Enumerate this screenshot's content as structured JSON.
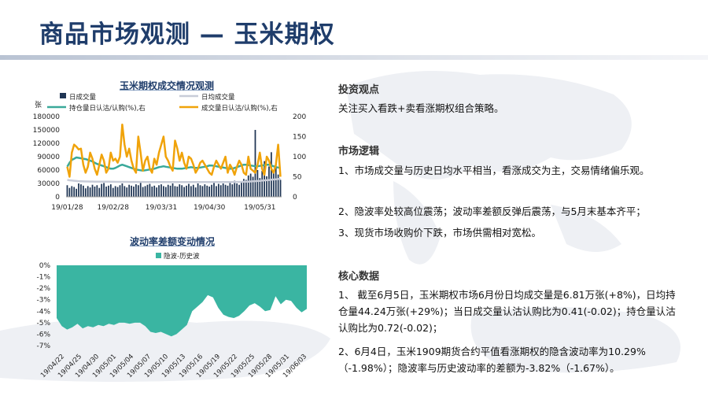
{
  "slide_title": "商品市场观测 — 玉米期权",
  "right_panel": {
    "views_heading": "投资观点",
    "views_text": "关注买入看跌+卖看涨期权组合策略。",
    "logic_heading": "市场逻辑",
    "logic_items": [
      "1、市场成交量与历史日均水平相当，看涨成交为主，交易情绪偏乐观。",
      "2、隐波率处较高位震荡；波动率差额反弹后震荡，与5月末基本齐平；",
      "3、现货市场收购价下跌，市场供需相对宽松。"
    ],
    "data_heading": "核心数据",
    "data_items": [
      "1、 截至6月5日，玉米期权市场6月份日均成交量是6.81万张(+8%)，日均持仓量44.24万张(+29%)；当日成交量认沽认购比为0.41(-0.02)；持仓量认沽认购比为0.72(-0.02)；",
      "2、6月4日，玉米1909期货合约平值看涨期权的隐含波动率为10.29%（-1.98%）；隐波率与历史波动率的差额为-3.82%（-1.67%）。"
    ]
  },
  "chart_data": [
    {
      "type": "bar",
      "title": "玉米期权成交情况观测",
      "ylabel_left": "张",
      "ylim_left": [
        0,
        180000
      ],
      "yticks_left": [
        "0",
        "30000",
        "60000",
        "90000",
        "120000",
        "150000",
        "180000"
      ],
      "ylim_right": [
        0,
        200
      ],
      "yticks_right": [
        "0",
        "50",
        "100",
        "150",
        "200"
      ],
      "xticks": [
        "19/01/28",
        "19/02/28",
        "19/03/31",
        "19/04/30",
        "19/05/31"
      ],
      "legend": [
        "日成交量",
        "日均成交量",
        "持仓量日认沽/认购(%),右",
        "成交量日认沽/认购(%),右"
      ],
      "colors": {
        "bar": "#1f3554",
        "avg": "#c8ccd8",
        "oi_ratio": "#3aa99a",
        "vol_ratio": "#f0a30a"
      },
      "series": [
        {
          "name": "日成交量",
          "axis": "left",
          "values": [
            26000,
            20000,
            24000,
            22000,
            18000,
            30000,
            28000,
            25000,
            19000,
            24000,
            21000,
            27000,
            23000,
            26000,
            20000,
            29000,
            31000,
            23000,
            25000,
            28000,
            20000,
            24000,
            22000,
            26000,
            30000,
            24000,
            21000,
            27000,
            25000,
            23000,
            28000,
            26000,
            32000,
            22000,
            24000,
            27000,
            29000,
            23000,
            25000,
            21000,
            26000,
            28000,
            24000,
            22000,
            27000,
            25000,
            30000,
            24000,
            23000,
            28000,
            26000,
            22000,
            25000,
            29000,
            24000,
            27000,
            21000,
            30000,
            26000,
            24000,
            28000,
            25000,
            23000,
            27000,
            31000,
            24000,
            29000,
            26000,
            30000,
            27000,
            25000,
            33000,
            28000,
            36000,
            30000,
            27000,
            34000,
            40000,
            38000,
            48000,
            52000,
            45000,
            150000,
            60000,
            42000,
            58000,
            80000,
            46000,
            68000,
            100000,
            55000,
            74000,
            50000,
            38000
          ]
        },
        {
          "name": "日均成交量",
          "axis": "left",
          "values": [
            38000,
            37000,
            36500,
            36000,
            35500,
            35000,
            34800,
            34600,
            34500,
            34400,
            34300,
            34200,
            34100,
            34000,
            34000,
            33900,
            33900,
            33800,
            33800,
            33700,
            33700,
            33600,
            33600,
            33600,
            33500,
            33500,
            33500,
            33400,
            33400,
            33400,
            33300,
            33300,
            33300,
            33300,
            33200,
            33200,
            33200,
            33200,
            33200,
            33100,
            33100,
            33100,
            33100,
            33100,
            33100,
            33100,
            33000,
            33000,
            33000,
            33000,
            33000,
            33000,
            33000,
            33000,
            33000,
            33000,
            33000,
            33000,
            33000,
            33000,
            33000,
            33000,
            33000,
            33000,
            33000,
            33000,
            33000,
            33000,
            33000,
            33000,
            33000,
            33000,
            33100,
            33200,
            33300,
            33400,
            33500,
            33700,
            33900,
            34100,
            34400,
            34700,
            35100,
            35500,
            35900,
            36300,
            36800,
            37300,
            37800,
            38300,
            38800,
            39300,
            39800,
            40200
          ]
        },
        {
          "name": "持仓量日认沽/认购(%),右",
          "axis": "right",
          "values": [
            75,
            85,
            92,
            95,
            98,
            97,
            96,
            95,
            94,
            92,
            90,
            88,
            85,
            82,
            80,
            78,
            76,
            74,
            72,
            70,
            70,
            72,
            75,
            78,
            80,
            78,
            76,
            74,
            72,
            70,
            68,
            67,
            66,
            65,
            66,
            67,
            68,
            69,
            70,
            72,
            74,
            75,
            76,
            75,
            74,
            73,
            72,
            71,
            70,
            70,
            70,
            71,
            72,
            73,
            74,
            73,
            72,
            72,
            73,
            74,
            75,
            76,
            78,
            78,
            77,
            76,
            75,
            74,
            73,
            72,
            71,
            70,
            70,
            72,
            74,
            76,
            78,
            80,
            80,
            79,
            78,
            77,
            76,
            76,
            77,
            78,
            79,
            80,
            80,
            78,
            76,
            74,
            73,
            72
          ]
        },
        {
          "name": "成交量日认沽/认购(%),右",
          "axis": "right",
          "values": [
            75,
            50,
            110,
            130,
            125,
            118,
            120,
            80,
            60,
            75,
            110,
            95,
            70,
            55,
            80,
            105,
            90,
            60,
            70,
            110,
            90,
            95,
            85,
            100,
            180,
            130,
            100,
            120,
            90,
            70,
            60,
            150,
            110,
            65,
            90,
            100,
            70,
            60,
            95,
            80,
            110,
            130,
            150,
            100,
            90,
            75,
            65,
            140,
            120,
            90,
            110,
            85,
            70,
            100,
            95,
            80,
            60,
            70,
            85,
            90,
            80,
            70,
            60,
            55,
            75,
            90,
            80,
            70,
            85,
            100,
            60,
            80,
            70,
            55,
            75,
            90,
            80,
            60,
            55,
            100,
            70,
            65,
            60,
            80,
            110,
            70,
            55,
            100,
            90,
            70,
            60,
            80,
            130,
            50
          ]
        }
      ]
    },
    {
      "type": "area",
      "title": "波动率差额变动情况",
      "legend": [
        "隐波-历史波"
      ],
      "color": "#3ab5a2",
      "ylim": [
        -7,
        0
      ],
      "yticks": [
        "0%",
        "-1%",
        "-2%",
        "-3%",
        "-4%",
        "-5%",
        "-6%",
        "-7%"
      ],
      "xticks": [
        "19/04/22",
        "19/04/25",
        "19/04/30",
        "19/05/01",
        "19/05/04",
        "19/05/07",
        "19/05/10",
        "19/05/13",
        "19/05/16",
        "19/05/19",
        "19/05/22",
        "19/05/25",
        "19/05/28",
        "19/05/31",
        "19/06/03"
      ],
      "series": [
        {
          "name": "隐波-历史波",
          "values": [
            -4.6,
            -5.3,
            -5.6,
            -5.4,
            -5.1,
            -5.5,
            -5.3,
            -5.4,
            -5.2,
            -5.3,
            -5.1,
            -5.2,
            -5.0,
            -5.0,
            -5.1,
            -5.0,
            -5.0,
            -5.3,
            -5.8,
            -5.9,
            -5.8,
            -6.0,
            -6.2,
            -6.0,
            -5.6,
            -5.2,
            -4.0,
            -3.6,
            -3.2,
            -2.6,
            -2.8,
            -3.7,
            -4.3,
            -4.5,
            -4.6,
            -4.4,
            -4.0,
            -3.5,
            -3.3,
            -3.6,
            -4.0,
            -3.9,
            -2.7,
            -3.4,
            -3.0,
            -3.1,
            -3.7,
            -4.1,
            -3.8
          ]
        }
      ]
    }
  ]
}
